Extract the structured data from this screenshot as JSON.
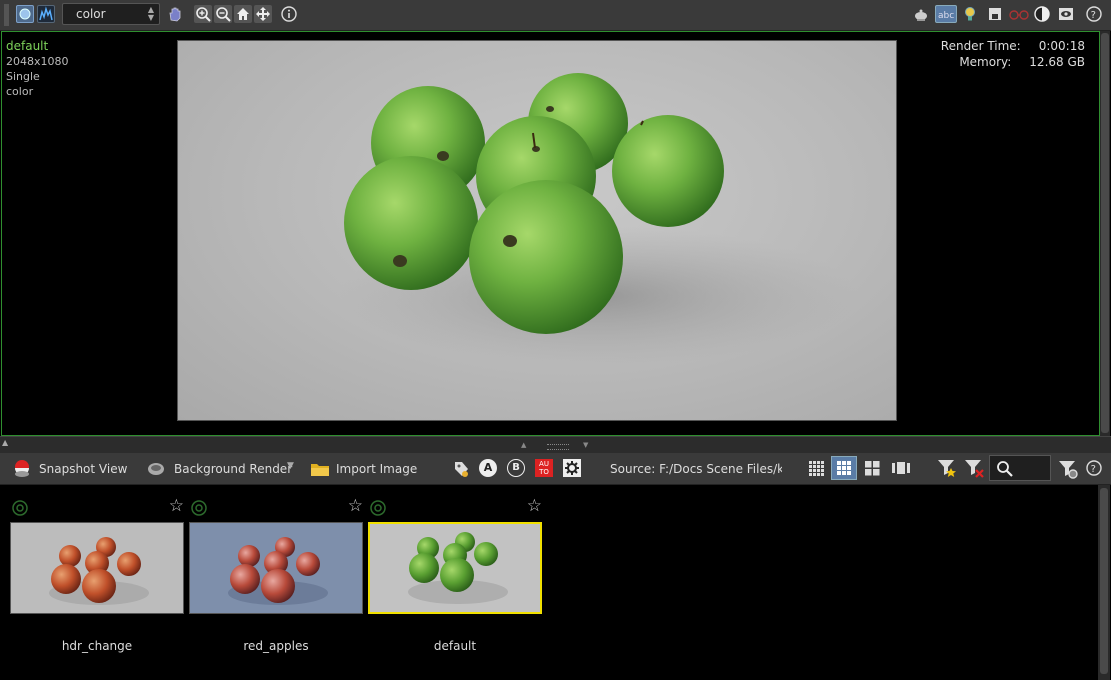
{
  "toolbar": {
    "display_select": "color",
    "icons": [
      "display-rgb-icon",
      "histogram-icon",
      "hand-pan-icon",
      "zoom-in-icon",
      "zoom-out-icon",
      "home-icon",
      "fit-icon",
      "info-icon",
      "teapot-icon",
      "text-overlay-icon",
      "bulb-icon",
      "save-icon",
      "stereo-glasses-icon",
      "contrast-icon",
      "eye-icon",
      "help-icon"
    ]
  },
  "render_info": {
    "name": "default",
    "resolution": "2048x1080",
    "mode": "Single",
    "plane": "color",
    "render_time_label": "Render Time:",
    "render_time": "0:00:18",
    "memory_label": "Memory:",
    "memory": "12.68 GB"
  },
  "snapshot_toolbar": {
    "snapshot_view": "Snapshot View",
    "background_render": "Background Render",
    "import_image": "Import Image",
    "source": "Source: F:/Docs Scene Files/kan",
    "auto_label": "AU TO",
    "label_a": "A",
    "label_b": "B"
  },
  "snapshots": [
    {
      "name": "hdr_change",
      "bg": "#bcbcbc",
      "apple": "red",
      "selected": false
    },
    {
      "name": "red_apples",
      "bg": "#7e8fab",
      "apple": "red",
      "selected": false
    },
    {
      "name": "default",
      "bg": "#c2c2c2",
      "apple": "green",
      "selected": true
    }
  ],
  "colors": {
    "accent_green": "#7dd25a",
    "selection_yellow": "#f1e000",
    "view_border": "#2f8f2f"
  }
}
